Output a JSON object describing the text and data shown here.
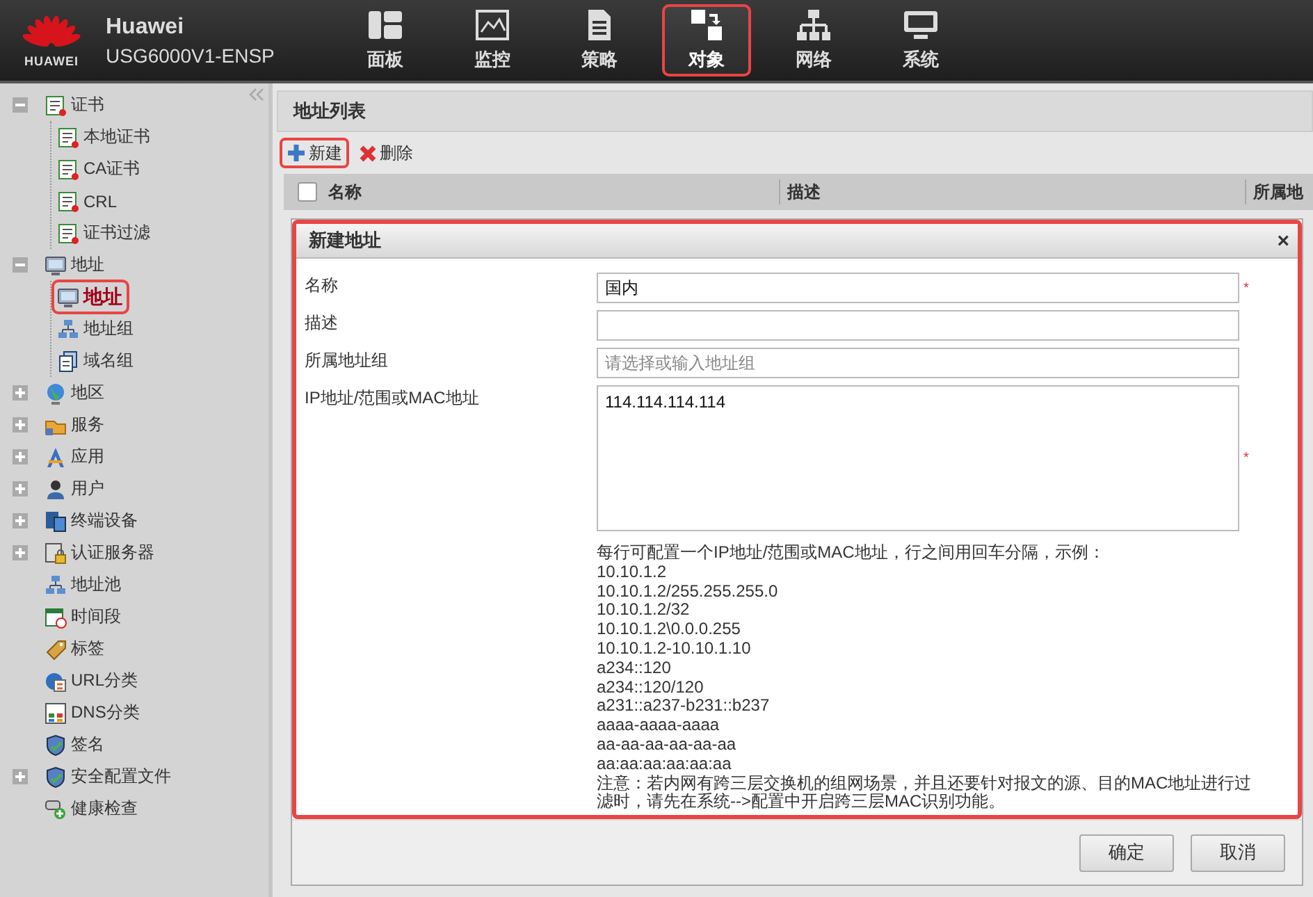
{
  "header": {
    "brand": "HUAWEI",
    "title": "Huawei",
    "subtitle": "USG6000V1-ENSP"
  },
  "nav": [
    {
      "label": "面板",
      "selected": false,
      "highlighted": false
    },
    {
      "label": "监控",
      "selected": false,
      "highlighted": false
    },
    {
      "label": "策略",
      "selected": false,
      "highlighted": false
    },
    {
      "label": "对象",
      "selected": true,
      "highlighted": true
    },
    {
      "label": "网络",
      "selected": false,
      "highlighted": false
    },
    {
      "label": "系统",
      "selected": false,
      "highlighted": false
    }
  ],
  "tree": [
    {
      "label": "证书",
      "kind": "group",
      "expanded": true,
      "selected": false,
      "highlighted": false,
      "children": [
        {
          "label": "本地证书",
          "selected": false,
          "highlighted": false
        },
        {
          "label": "CA证书",
          "selected": false,
          "highlighted": false
        },
        {
          "label": "CRL",
          "selected": false,
          "highlighted": false
        },
        {
          "label": "证书过滤",
          "selected": false,
          "highlighted": false
        }
      ]
    },
    {
      "label": "地址",
      "kind": "group",
      "expanded": true,
      "selected": false,
      "highlighted": false,
      "children": [
        {
          "label": "地址",
          "selected": true,
          "highlighted": true
        },
        {
          "label": "地址组",
          "selected": false,
          "highlighted": false
        },
        {
          "label": "域名组",
          "selected": false,
          "highlighted": false
        }
      ]
    },
    {
      "label": "地区",
      "kind": "group",
      "expanded": false,
      "selected": false,
      "highlighted": false
    },
    {
      "label": "服务",
      "kind": "group",
      "expanded": false,
      "selected": false,
      "highlighted": false
    },
    {
      "label": "应用",
      "kind": "group",
      "expanded": false,
      "selected": false,
      "highlighted": false
    },
    {
      "label": "用户",
      "kind": "group",
      "expanded": false,
      "selected": false,
      "highlighted": false
    },
    {
      "label": "终端设备",
      "kind": "group",
      "expanded": false,
      "selected": false,
      "highlighted": false
    },
    {
      "label": "认证服务器",
      "kind": "group",
      "expanded": false,
      "selected": false,
      "highlighted": false
    },
    {
      "label": "地址池",
      "kind": "leaf",
      "selected": false,
      "highlighted": false
    },
    {
      "label": "时间段",
      "kind": "leaf",
      "selected": false,
      "highlighted": false
    },
    {
      "label": "标签",
      "kind": "leaf",
      "selected": false,
      "highlighted": false
    },
    {
      "label": "URL分类",
      "kind": "leaf",
      "selected": false,
      "highlighted": false
    },
    {
      "label": "DNS分类",
      "kind": "leaf",
      "selected": false,
      "highlighted": false
    },
    {
      "label": "签名",
      "kind": "leaf",
      "selected": false,
      "highlighted": false
    },
    {
      "label": "安全配置文件",
      "kind": "group",
      "expanded": false,
      "selected": false,
      "highlighted": false
    },
    {
      "label": "健康检查",
      "kind": "leaf",
      "selected": false,
      "highlighted": false
    }
  ],
  "panel": {
    "title": "地址列表",
    "toolbar": [
      {
        "label": "新建",
        "kind": "add",
        "highlighted": true
      },
      {
        "label": "删除",
        "kind": "delete",
        "highlighted": false
      }
    ],
    "table": {
      "select_all": {
        "checked": false
      },
      "columns": [
        "名称",
        "描述",
        "所属地"
      ]
    }
  },
  "dialog": {
    "title": "新建地址",
    "close": "×",
    "highlighted": true,
    "required_mark": "*",
    "fields": [
      {
        "label": "名称",
        "kind": "text",
        "value": "国内",
        "required": true
      },
      {
        "label": "描述",
        "kind": "text",
        "required": false
      },
      {
        "label": "所属地址组",
        "kind": "text",
        "placeholder": "请选择或输入地址组",
        "required": false
      },
      {
        "label": "IP地址/范围或MAC地址",
        "kind": "textarea",
        "value": "114.114.114.114",
        "required": true
      }
    ],
    "help_lines": [
      "每行可配置一个IP地址/范围或MAC地址，行之间用回车分隔，示例：",
      "10.10.1.2",
      "10.10.1.2/255.255.255.0",
      "10.10.1.2/32",
      "10.10.1.2\\0.0.0.255",
      "10.10.1.2-10.10.1.10",
      "a234::120",
      "a234::120/120",
      "a231::a237-b231::b237",
      "aaaa-aaaa-aaaa",
      "aa-aa-aa-aa-aa-aa",
      "aa:aa:aa:aa:aa:aa",
      "注意：若内网有跨三层交换机的组网场景，并且还要针对报文的源、目的MAC地址进行过滤时，请先在系统-->配置中开启跨三层MAC识别功能。"
    ],
    "buttons": [
      "确定",
      "取消"
    ]
  }
}
